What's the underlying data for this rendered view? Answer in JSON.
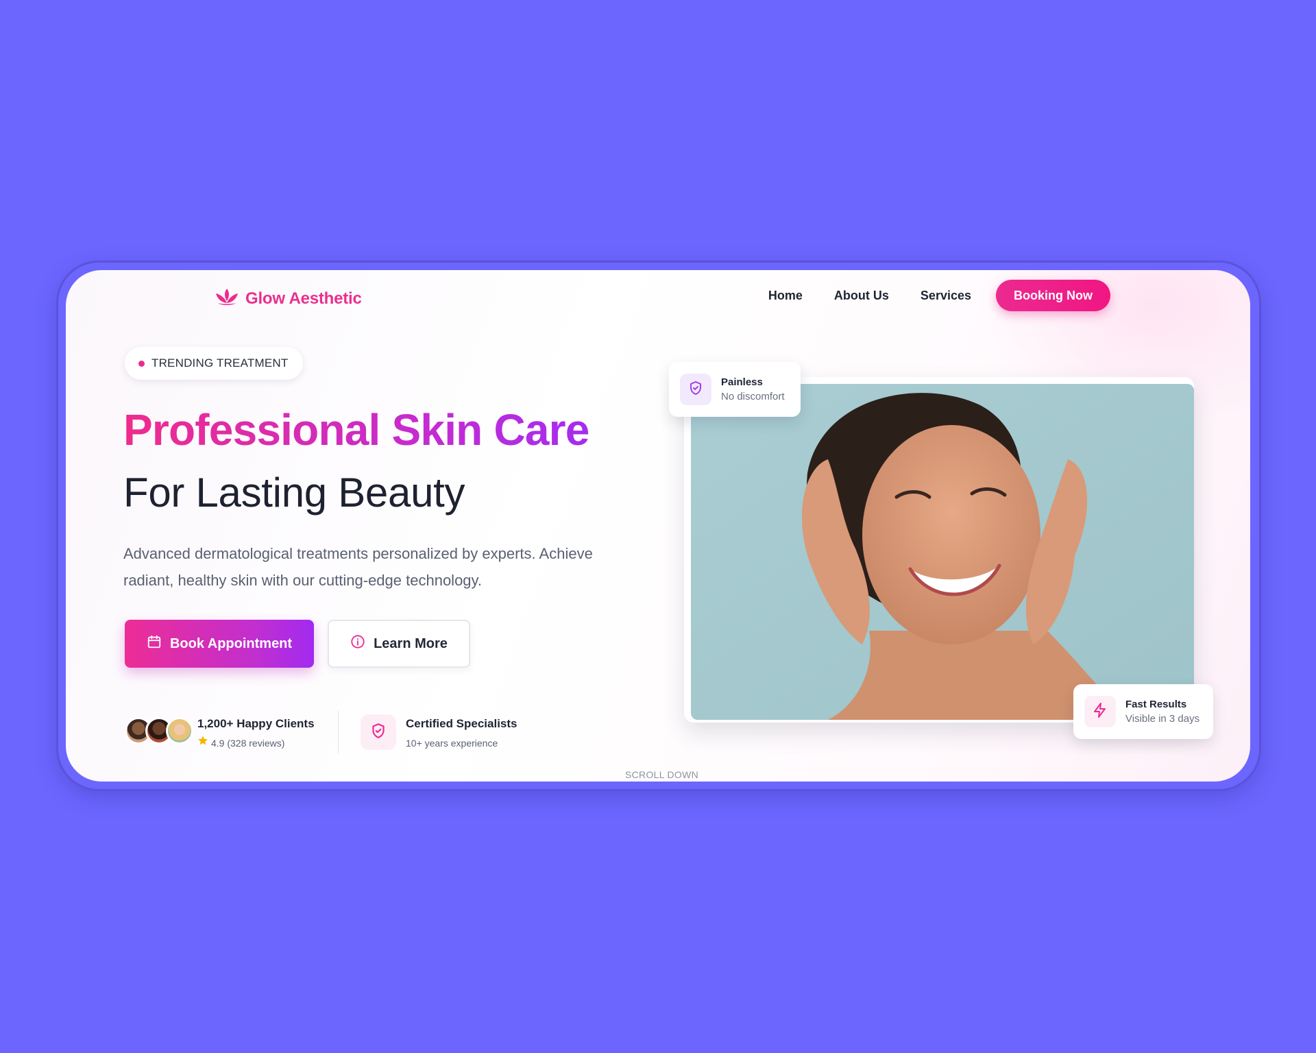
{
  "brand": {
    "name": "Glow Aesthetic",
    "accent": "#ec2a8f",
    "gradient_end": "#a52cf0"
  },
  "nav": {
    "links": [
      "Home",
      "About Us",
      "Services"
    ],
    "cta": "Booking Now"
  },
  "hero": {
    "badge": "TRENDING TREATMENT",
    "title": "Professional Skin Care",
    "subtitle": "For Lasting Beauty",
    "description": "Advanced dermatological treatments personalized by experts. Achieve radiant, healthy skin with our cutting-edge technology.",
    "primary_button": "Book Appointment",
    "secondary_button": "Learn More"
  },
  "stats": {
    "clients": {
      "title": "1,200+ Happy Clients",
      "rating": "4.9 (328 reviews)"
    },
    "certified": {
      "title": "Certified Specialists",
      "subtitle": "10+ years experience"
    }
  },
  "features": {
    "painless": {
      "title": "Painless",
      "subtitle": "No discomfort"
    },
    "fast": {
      "title": "Fast Results",
      "subtitle": "Visible in 3 days"
    }
  },
  "scroll_hint": "SCROLL DOWN",
  "icons": {
    "logo": "lotus-icon",
    "book": "calendar-icon",
    "learn": "info-icon",
    "certified": "shield-check-icon",
    "painless": "shield-check-icon",
    "fast": "lightning-icon",
    "rating": "star-icon"
  }
}
